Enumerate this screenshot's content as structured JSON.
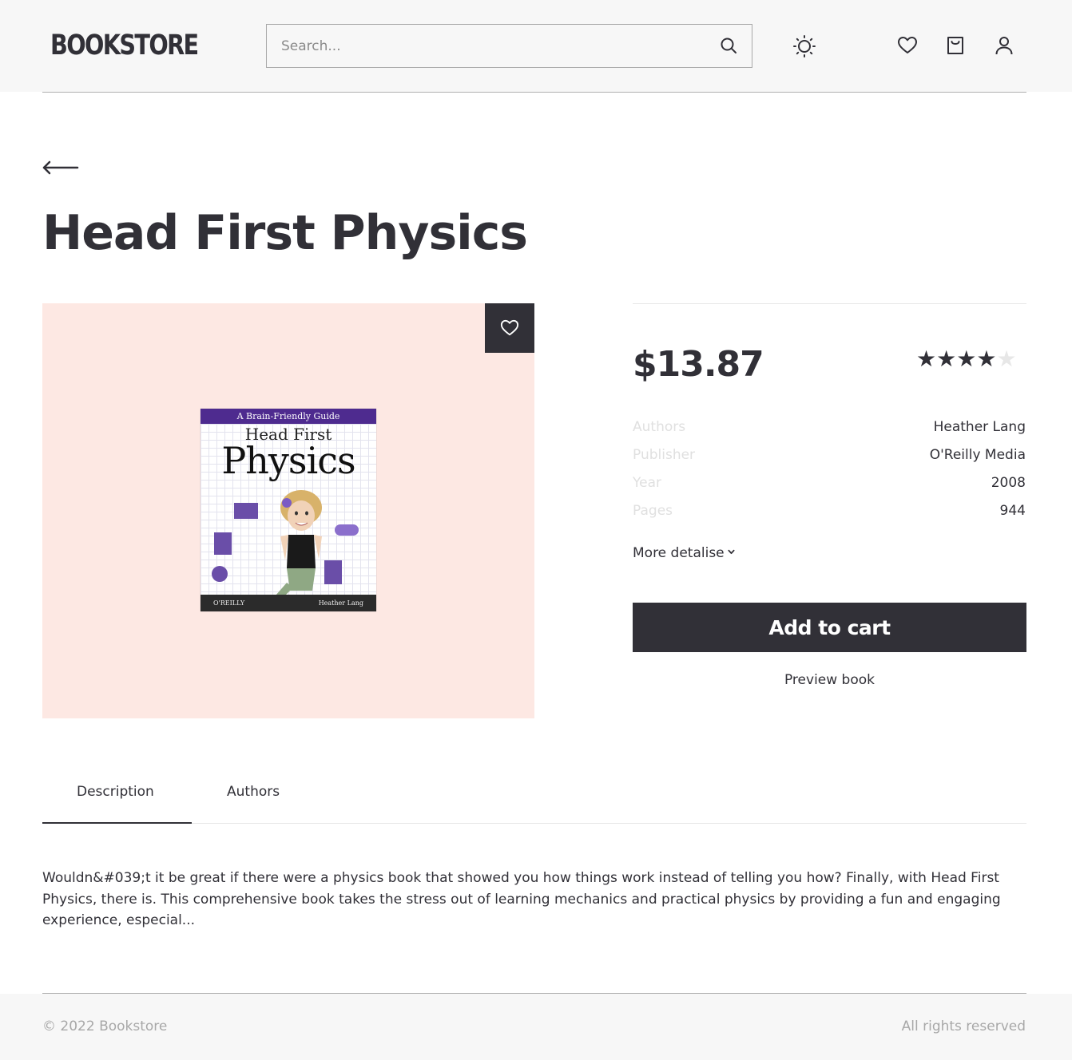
{
  "header": {
    "logo": "BOOKSTORE",
    "search_placeholder": "Search..."
  },
  "book": {
    "title": "Head First Physics",
    "price": "$13.87",
    "rating": 4,
    "rating_max": 5,
    "info": [
      {
        "label": "Authors",
        "value": "Heather Lang"
      },
      {
        "label": "Publisher",
        "value": "O'Reilly Media"
      },
      {
        "label": "Year",
        "value": "2008"
      },
      {
        "label": "Pages",
        "value": "944"
      }
    ],
    "more_details_label": "More detalise",
    "add_to_cart_label": "Add to cart",
    "preview_label": "Preview book",
    "cover": {
      "top_band": "A Brain-Friendly Guide",
      "title_line1": "Head First",
      "title_line2": "Physics",
      "publisher_mark": "O'REILLY",
      "author": "Heather Lang",
      "background": "#fde8e3",
      "band_color": "#4e2b8f"
    }
  },
  "tabs": [
    {
      "label": "Description",
      "active": true
    },
    {
      "label": "Authors",
      "active": false
    }
  ],
  "description": "Wouldn&#039;t it be great if there were a physics book that showed you how things work instead of telling you how? Finally, with Head First Physics, there is. This comprehensive book takes the stress out of learning mechanics and practical physics by providing a fun and engaging experience, especial...",
  "footer": {
    "copyright": "© 2022 Bookstore",
    "rights": "All rights reserved"
  },
  "icons": {
    "search": "search-icon",
    "theme": "sun-icon",
    "favorites": "heart-icon",
    "cart": "shopping-bag-icon",
    "account": "user-icon",
    "back": "arrow-left-icon"
  },
  "colors": {
    "primary": "#313037",
    "muted": "#a8a8a8",
    "cover_bg": "#fde8e3"
  }
}
